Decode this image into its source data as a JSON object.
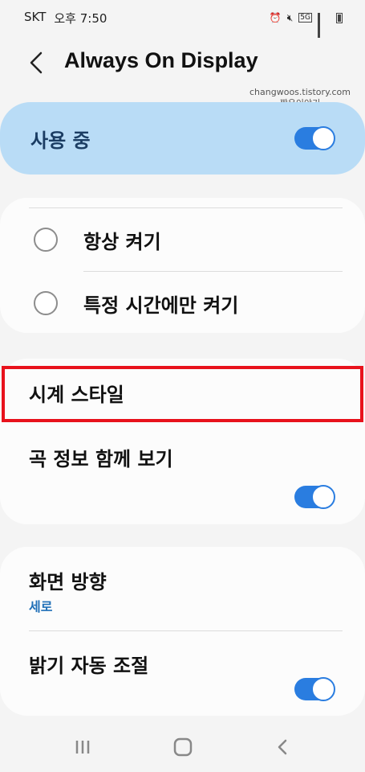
{
  "status_bar": {
    "carrier": "SKT",
    "time": "오후 7:50",
    "icons": [
      "alarm-icon",
      "mute-icon",
      "5g-icon",
      "signal-icon",
      "battery-icon"
    ],
    "network_label": "5G"
  },
  "header": {
    "back_icon": "chevron-left-icon",
    "title": "Always On Display"
  },
  "watermark": {
    "line1": "changwoos.tistory.com",
    "line2": "짱우이야기"
  },
  "master": {
    "label": "사용 중",
    "toggle_on": true
  },
  "display_mode": {
    "options": [
      {
        "label": "항상 켜기",
        "selected": false
      },
      {
        "label": "특정 시간에만 켜기",
        "selected": false
      }
    ]
  },
  "clock_section": {
    "clock_style_label": "시계 스타일",
    "song_info_label": "곡 정보 함께 보기",
    "song_info_toggle_on": true
  },
  "screen_section": {
    "orientation_label": "화면 방향",
    "orientation_value": "세로",
    "auto_brightness_label": "밝기 자동 조절",
    "auto_brightness_toggle_on": true
  },
  "nav": {
    "icons": [
      "recents-icon",
      "home-icon",
      "back-icon"
    ]
  },
  "colors": {
    "accent": "#2a7de0",
    "master_bg": "#b9dcf6",
    "highlight": "#e8121c",
    "subtext": "#1f6fb7"
  }
}
